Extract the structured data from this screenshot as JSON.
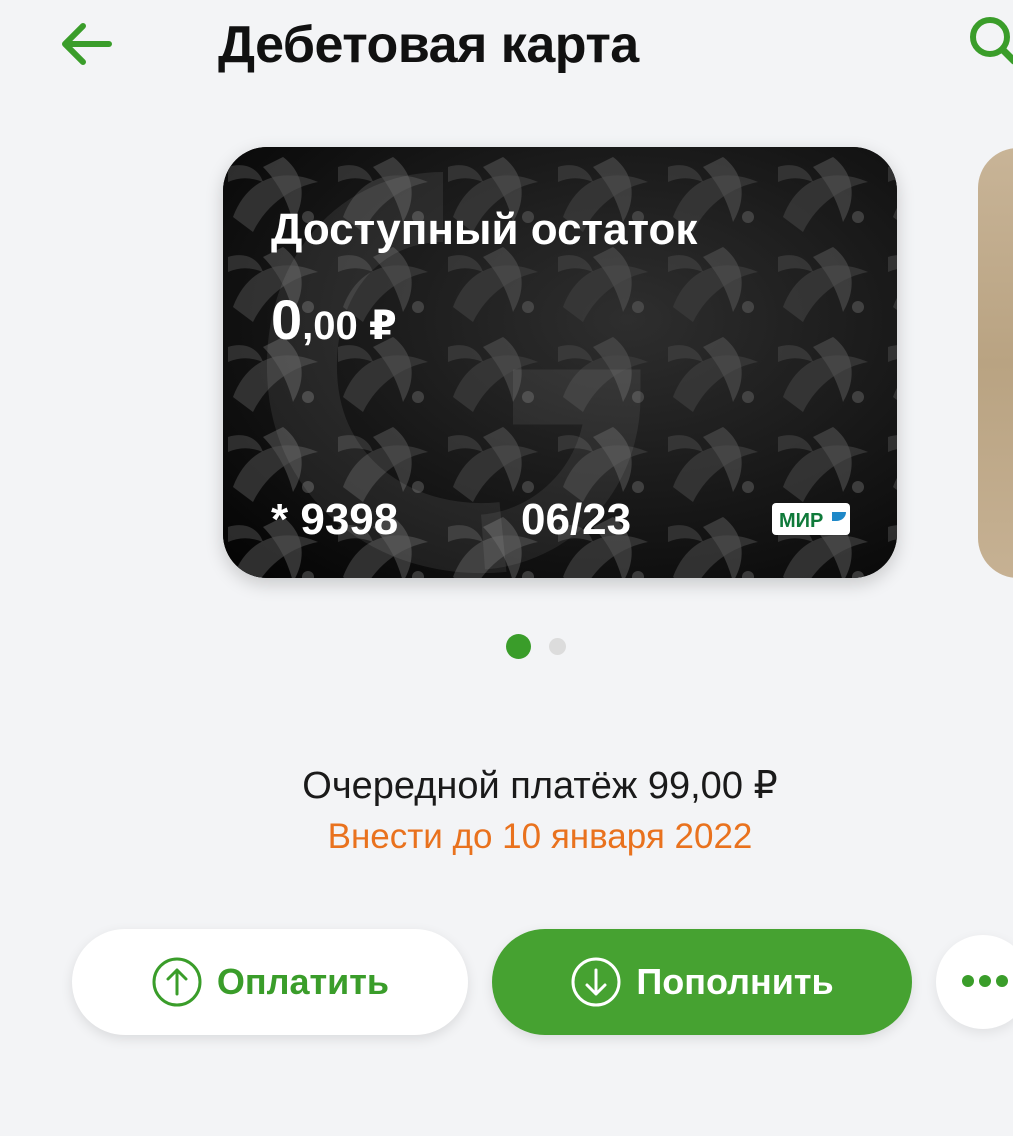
{
  "header": {
    "title": "Дебетовая карта",
    "back_icon": "arrow-left-icon",
    "search_icon": "search-icon"
  },
  "card": {
    "balance_label": "Доступный остаток",
    "balance_main": "0",
    "balance_rest": ",00 ₽",
    "number": "* 9398",
    "expiry": "06/23",
    "payment_system": "МИР"
  },
  "carousel": {
    "page_count": 2,
    "active_page": 1
  },
  "payment": {
    "next_payment": "Очередной платёж 99,00 ₽",
    "due": "Внести до 10 января 2022"
  },
  "actions": {
    "pay_label": "Оплатить",
    "topup_label": "Пополнить",
    "pay_icon": "arrow-up-circle-icon",
    "topup_icon": "arrow-down-circle-icon",
    "more_icon": "more-dots-icon"
  },
  "colors": {
    "accent": "#3a9d2a",
    "accent_button": "#46a231",
    "due_text": "#e9721e",
    "background": "#f3f4f6",
    "card_background": "#0b0b0b"
  }
}
